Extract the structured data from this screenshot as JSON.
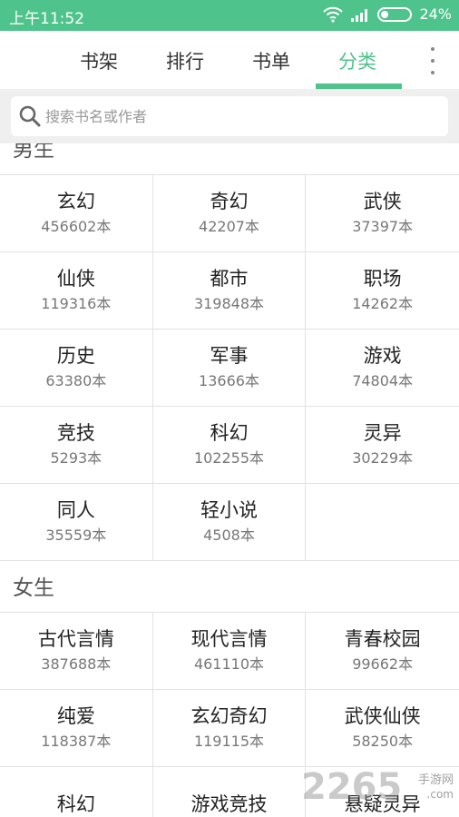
{
  "status_bar": {
    "time": "上午11:52",
    "battery": "24%",
    "battery_level": 0.24,
    "accent_color": "#4fc38c"
  },
  "tabs": [
    {
      "label": "书架",
      "active": false
    },
    {
      "label": "排行",
      "active": false
    },
    {
      "label": "书单",
      "active": false
    },
    {
      "label": "分类",
      "active": true
    }
  ],
  "search": {
    "placeholder": "搜索书名或作者",
    "icon": "search-icon"
  },
  "sections": [
    {
      "title": "男生",
      "categories": [
        {
          "name": "玄幻",
          "count": "456602本"
        },
        {
          "name": "奇幻",
          "count": "42207本"
        },
        {
          "name": "武侠",
          "count": "37397本"
        },
        {
          "name": "仙侠",
          "count": "119316本"
        },
        {
          "name": "都市",
          "count": "319848本"
        },
        {
          "name": "职场",
          "count": "14262本"
        },
        {
          "name": "历史",
          "count": "63380本"
        },
        {
          "name": "军事",
          "count": "13666本"
        },
        {
          "name": "游戏",
          "count": "74804本"
        },
        {
          "name": "竞技",
          "count": "5293本"
        },
        {
          "name": "科幻",
          "count": "102255本"
        },
        {
          "name": "灵异",
          "count": "30229本"
        },
        {
          "name": "同人",
          "count": "35559本"
        },
        {
          "name": "轻小说",
          "count": "4508本"
        }
      ]
    },
    {
      "title": "女生",
      "categories": [
        {
          "name": "古代言情",
          "count": "387688本"
        },
        {
          "name": "现代言情",
          "count": "461110本"
        },
        {
          "name": "青春校园",
          "count": "99662本"
        },
        {
          "name": "纯爱",
          "count": "118387本"
        },
        {
          "name": "玄幻奇幻",
          "count": "119115本"
        },
        {
          "name": "武侠仙侠",
          "count": "58250本"
        },
        {
          "name": "科幻",
          "count": ""
        },
        {
          "name": "游戏竞技",
          "count": ""
        },
        {
          "name": "悬疑灵异",
          "count": ""
        }
      ]
    }
  ],
  "watermark": {
    "number": "2265",
    "line1": "手游网",
    "line2": ".com"
  }
}
